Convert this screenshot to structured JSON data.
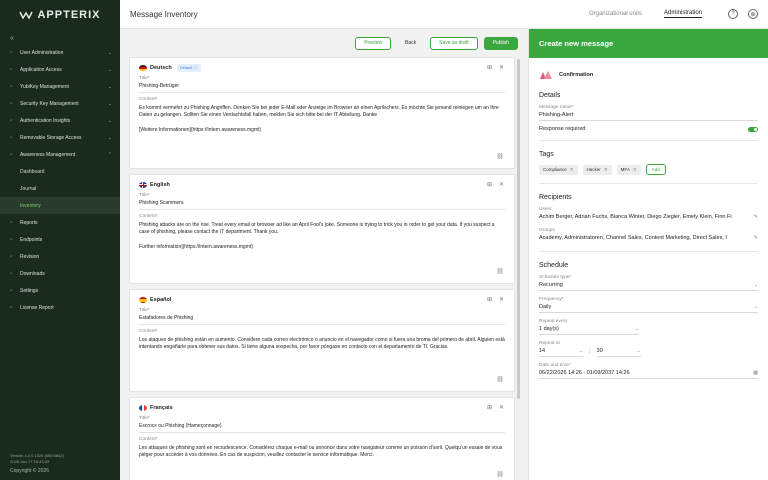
{
  "sidebar": {
    "logo": "APPTERIX",
    "collapse": "«",
    "items": [
      {
        "label": "User Administration",
        "icon": "user-icon",
        "chevron": "⌄"
      },
      {
        "label": "Application Access",
        "icon": "app-access-icon",
        "chevron": "⌄"
      },
      {
        "label": "YubiKey Management",
        "icon": "key-icon",
        "chevron": "⌄"
      },
      {
        "label": "Security Key Management",
        "icon": "security-key-icon",
        "chevron": "⌄"
      },
      {
        "label": "Authentication Insights",
        "icon": "insights-icon",
        "chevron": "⌄"
      },
      {
        "label": "Removable Storage Access",
        "icon": "storage-icon",
        "chevron": "⌄"
      },
      {
        "label": "Awareness Management",
        "icon": "awareness-icon",
        "chevron": "⌃"
      }
    ],
    "sub_items": [
      "Dashboard",
      "Journal",
      "Inventory"
    ],
    "items2": [
      {
        "label": "Reports",
        "icon": "reports-icon"
      },
      {
        "label": "Endpoints",
        "icon": "endpoints-icon"
      },
      {
        "label": "Revision",
        "icon": "revision-icon"
      },
      {
        "label": "Downloads",
        "icon": "downloads-icon"
      },
      {
        "label": "Settings",
        "icon": "settings-icon"
      },
      {
        "label": "License Report",
        "icon": "license-icon"
      }
    ],
    "version": "Version 4.2.0.1329 (6f594642)",
    "build_date": "2026-Jan-17 18:43:43",
    "copyright": "Copyright © 2026"
  },
  "topbar": {
    "title": "Message Inventory",
    "org_units": "Organizational units",
    "administration": "Administration",
    "help_icon": "?",
    "globe_icon": "⊕"
  },
  "actions": {
    "preview": "Preview",
    "back": "Back",
    "save_draft": "Save as draft",
    "publish": "Publish"
  },
  "cards": [
    {
      "lang": "Deutsch",
      "badge": "Default ⓘ",
      "title_label": "Title*",
      "title": "Phishing-Betrüger",
      "content_label": "Content*",
      "content": "Es kommt vermehrt zu Phishing Angriffen. Denken Sie bei jeder E-Mail oder Anzeige im Browser an einen Aprilscherz. Es möchte Sie jemand reinlegen um an Ihre Daten zu gelangen. Sollten Sie einen Verdachtsfall haben, melden Sie sich bitte bei der IT Abteilung. Danke\n\n[Weitere Informationen](https://intern.awareness.mgmt)"
    },
    {
      "lang": "English",
      "badge": "",
      "title_label": "Title*",
      "title": "Phishing Scammers",
      "content_label": "Content*",
      "content": "Phishing attacks are on the rise. Treat every email or browser ad like an April Fool's joke. Someone is trying to trick you in order to get your data. If you suspect a case of phishing, please contact the IT department. Thank you.\n\nFurther information](https://intern.awareness.mgmt)"
    },
    {
      "lang": "Español",
      "badge": "",
      "title_label": "Title*",
      "title": "Estafadores de Phishing",
      "content_label": "Content*",
      "content": "Los ataques de phishing están en aumento. Considere cada correo electrónico o anuncio en el navegador como si fuera una broma del primero de abril. Alguien está intentando engañarle para obtener sus datos. Si tiene alguna sospecha, por favor póngase en contacto con el departamento de TI. Gracias."
    },
    {
      "lang": "Français",
      "badge": "",
      "title_label": "Title*",
      "title": "Escrocs ou Phishing (Hameçonnage)",
      "content_label": "Content*",
      "content": "Les attaques de phishing sont en recrudescence. Considérez chaque e-mail ou annonce dans votre navigateur comme un poisson d'avril. Quelqu'un essaie de vous piéger pour accéder à vos données. En cas de suspicion, veuillez contacter le service informatique. Merci."
    }
  ],
  "panel": {
    "header": "Create new message",
    "type": "Confirmation",
    "details_title": "Details",
    "name_label": "Message name*",
    "name_value": "Phishing-Alert",
    "response_required": "Response required",
    "response_required_on": true,
    "tags_title": "Tags",
    "tags": [
      "Compliance",
      "Hacker",
      "MFA"
    ],
    "tag_add": "Add",
    "recipients_title": "Recipients",
    "users_label": "Users",
    "users_value": "Achim Berger, Adrian Fuchs, Bianca Winter, Diego Ziegler, Emely Klein, Finn Fi",
    "groups_label": "Groups",
    "groups_value": "Academy, Administratoren, Channel Sales, Content Marketing, Direct Sales, I",
    "schedule_title": "Schedule",
    "schedule_type_label": "Schedule type*",
    "schedule_type_value": "Recurring",
    "frequency_label": "Frequency*",
    "frequency_value": "Daily",
    "repeat_every_label": "Repeat every",
    "repeat_every_value": "1 day(s)",
    "repeat_at_label": "Repeat at",
    "repeat_hour": "14",
    "repeat_min": "30",
    "date_time_label": "Date and time*",
    "date_time_value": "06/22/2026 14:26 - 01/09/2037 14:26"
  }
}
